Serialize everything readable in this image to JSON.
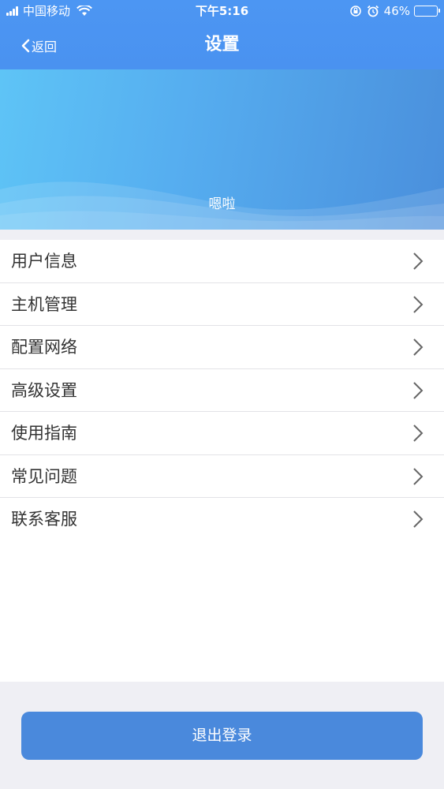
{
  "status_bar": {
    "carrier": "中国移动",
    "time": "下午5:16",
    "battery": "46%",
    "battery_level": 0.46
  },
  "nav": {
    "back_label": "返回",
    "title": "设置"
  },
  "banner": {
    "text": "嗯啦"
  },
  "menu": {
    "items": [
      {
        "label": "用户信息"
      },
      {
        "label": "主机管理"
      },
      {
        "label": "配置网络"
      },
      {
        "label": "高级设置"
      },
      {
        "label": "使用指南"
      },
      {
        "label": "常见问题"
      },
      {
        "label": "联系客服"
      }
    ]
  },
  "logout_label": "退出登录",
  "colors": {
    "nav_bg": "#4c96f3",
    "logout_bg": "#4a89dc",
    "page_bg": "#efeff4"
  }
}
